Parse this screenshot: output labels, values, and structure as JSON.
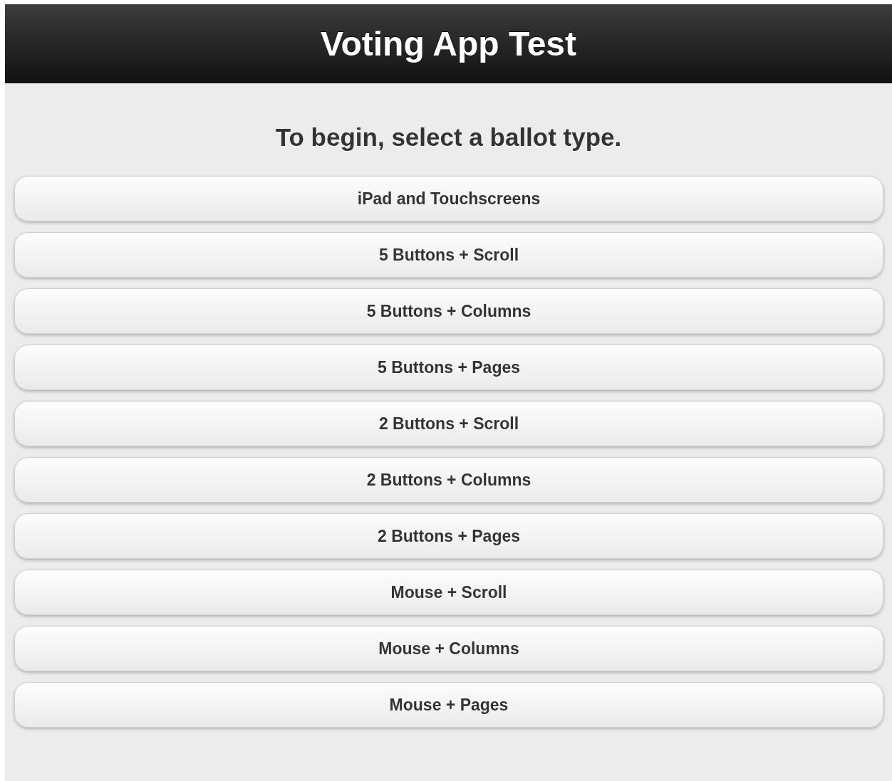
{
  "header": {
    "title": "Voting App Test"
  },
  "prompt": "To begin, select a ballot type.",
  "ballot_types": [
    {
      "label": "iPad and Touchscreens"
    },
    {
      "label": "5 Buttons + Scroll"
    },
    {
      "label": "5 Buttons + Columns"
    },
    {
      "label": "5 Buttons + Pages"
    },
    {
      "label": "2 Buttons + Scroll"
    },
    {
      "label": "2 Buttons + Columns"
    },
    {
      "label": "2 Buttons + Pages"
    },
    {
      "label": "Mouse + Scroll"
    },
    {
      "label": "Mouse + Columns"
    },
    {
      "label": "Mouse + Pages"
    }
  ]
}
